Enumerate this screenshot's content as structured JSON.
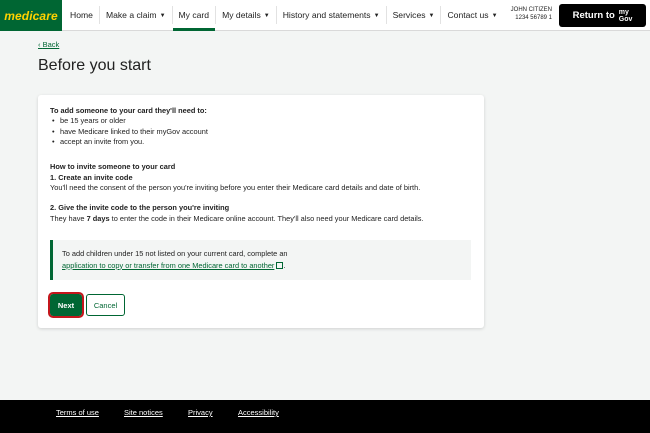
{
  "brand": {
    "logo_text": "medicare",
    "accent": "#006633",
    "logo_color": "#ffd200"
  },
  "nav": {
    "items": [
      {
        "label": "Home"
      },
      {
        "label": "Make a claim"
      },
      {
        "label": "My card"
      },
      {
        "label": "My details"
      },
      {
        "label": "History and statements"
      },
      {
        "label": "Services"
      },
      {
        "label": "Contact us"
      }
    ],
    "active": "My card"
  },
  "user": {
    "name": "JOHN CITIZEN",
    "card_number": "1234 56789 1"
  },
  "mygov_button": {
    "label": "Return to",
    "brand_top": "my",
    "brand_bottom": "Gov"
  },
  "back_link": "Back",
  "page_title": "Before you start",
  "content": {
    "intro": "To add someone to your card they'll need to:",
    "requirements": [
      "be 15 years or older",
      "have Medicare linked to their myGov account",
      "accept an invite from you."
    ],
    "how_heading": "How to invite someone to your card",
    "step1_heading": "1. Create an invite code",
    "step1_text": "You'll need the consent of the person you're inviting before you enter their Medicare card details and date of birth.",
    "step2_heading": "2. Give the invite code to the person you're inviting",
    "step2_text_before": "They have ",
    "step2_days": "7 days",
    "step2_text_after": " to enter the code in their Medicare online account. They'll also need your Medicare card details."
  },
  "callout": {
    "text": "To add children under 15 not listed on your current card, complete an",
    "link_text": "application to copy or transfer from one Medicare card to another",
    "suffix": "."
  },
  "buttons": {
    "next": "Next",
    "cancel": "Cancel"
  },
  "footer": {
    "links": [
      "Terms of use",
      "Site notices",
      "Privacy",
      "Accessibility"
    ]
  }
}
